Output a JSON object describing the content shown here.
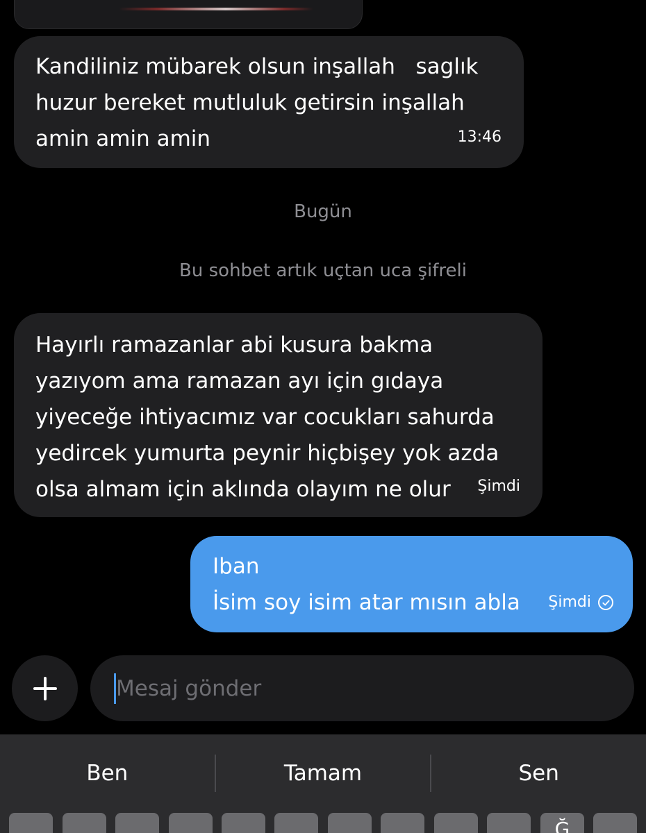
{
  "conversation": {
    "messages": [
      {
        "direction": "incoming",
        "lines": [
          "Kandiliniz mübarek olsun inşallah   saglık",
          "huzur bereket mutluluk getirsin inşallah",
          "amin amin amin"
        ],
        "time": "13:46"
      },
      {
        "direction": "incoming",
        "lines": [
          "Hayırlı ramazanlar abi kusura bakma",
          "yazıyom ama ramazan ayı için gıdaya",
          "yiyeceğe ihtiyacımız var cocukları sahurda",
          "yedircek yumurta peynir hiçbişey yok azda",
          "olsa almam için aklında olayım ne olur"
        ],
        "time": "Şimdi"
      },
      {
        "direction": "outgoing",
        "lines": [
          "Iban",
          "İsim soy isim atar mısın abla"
        ],
        "time": "Şimdi",
        "status_icon": "sent-check-circle-icon"
      }
    ],
    "date_separator": "Bugün",
    "encryption_notice": "Bu sohbet artık uçtan uca şifreli"
  },
  "compose": {
    "placeholder": "Mesaj gönder",
    "add_icon": "plus-icon"
  },
  "keyboard": {
    "suggestions": [
      "Ben",
      "Tamam",
      "Sen"
    ],
    "partial_key_letter": "Ğ"
  },
  "colors": {
    "background": "#000000",
    "incoming_bubble": "#202022",
    "outgoing_bubble": "#4a9aec",
    "system_text": "#8e8e93",
    "keyboard_bg": "#2c2c2e"
  }
}
